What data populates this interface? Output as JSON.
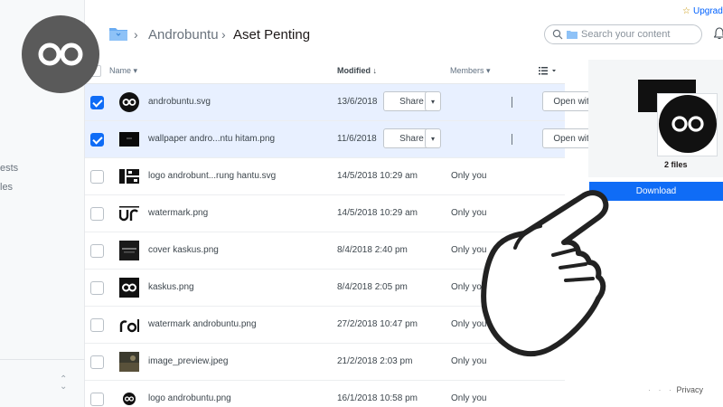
{
  "header": {
    "breadcrumb_root": "Androbuntu",
    "breadcrumb_sep": "›",
    "breadcrumb_current": "Aset Penting",
    "search_placeholder": "Search your content",
    "upgrade_label": "Upgrad"
  },
  "sidebar": {
    "partial_items": [
      "ests",
      "les"
    ]
  },
  "table": {
    "col_name": "Name",
    "col_modified": "Modified",
    "col_members": "Members",
    "share_label": "Share",
    "open_with_label": "Open with"
  },
  "rows": [
    {
      "name": "androbuntu.svg",
      "modified": "13/6/2018",
      "members": "",
      "selected": true,
      "thumb": "infinity-circle"
    },
    {
      "name": "wallpaper andro...ntu hitam.png",
      "modified": "11/6/2018",
      "members": "",
      "selected": true,
      "thumb": "dark-wallpaper"
    },
    {
      "name": "logo androbunt...rung hantu.svg",
      "modified": "14/5/2018 10:29 am",
      "members": "Only you",
      "selected": false,
      "thumb": "ab-text"
    },
    {
      "name": "watermark.png",
      "modified": "14/5/2018 10:29 am",
      "members": "Only you",
      "selected": false,
      "thumb": "ur-text"
    },
    {
      "name": "cover kaskus.png",
      "modified": "8/4/2018 2:40 pm",
      "members": "Only you",
      "selected": false,
      "thumb": "dark-cover"
    },
    {
      "name": "kaskus.png",
      "modified": "8/4/2018 2:05 pm",
      "members": "Only you",
      "selected": false,
      "thumb": "infinity-square"
    },
    {
      "name": "watermark androbuntu.png",
      "modified": "27/2/2018 10:47 pm",
      "members": "Only you",
      "selected": false,
      "thumb": "rol-text"
    },
    {
      "name": "image_preview.jpeg",
      "modified": "21/2/2018 2:03 pm",
      "members": "Only you",
      "selected": false,
      "thumb": "photo"
    },
    {
      "name": "logo androbuntu.png",
      "modified": "16/1/2018 10:58 pm",
      "members": "Only you",
      "selected": false,
      "thumb": "infinity-small"
    }
  ],
  "panel": {
    "files_count": "2 files",
    "download_label": "Download"
  },
  "footer": {
    "privacy": "Privacy"
  },
  "colors": {
    "accent": "#0f6cf6",
    "selected_row": "#e8f0ff"
  }
}
